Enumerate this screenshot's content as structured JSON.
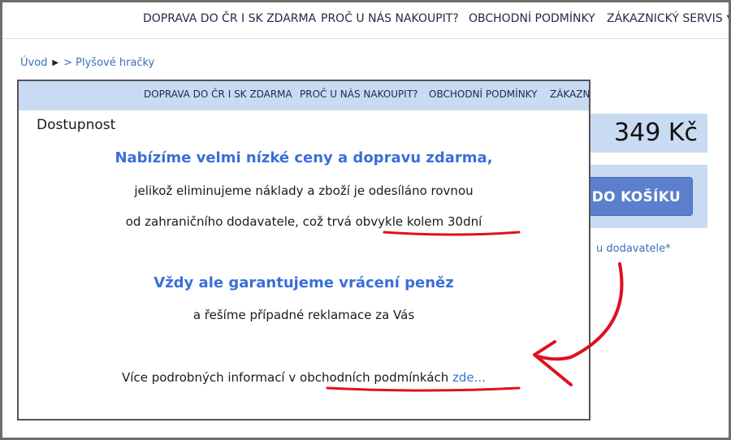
{
  "top_nav": {
    "items": [
      "DOPRAVA DO ČR I SK ZDARMA",
      "PROČ U NÁS NAKOUPIT?",
      "OBCHODNÍ PODMÍNKY",
      "ZÁKAZNICKÝ SERVIS"
    ]
  },
  "breadcrumb": {
    "home": "Úvod",
    "current": "> Plyšové hračky"
  },
  "product": {
    "price": "349 Kč",
    "cart_label": "DO KOŠÍKU",
    "supplier_note": "u dodavatele*"
  },
  "popup": {
    "nav_items": [
      "DOPRAVA DO ČR I SK ZDARMA",
      "PROČ U NÁS NAKOUPIT?",
      "OBCHODNÍ PODMÍNKY",
      "ZÁKAZNI"
    ],
    "title": "Dostupnost",
    "headline1": "Nabízíme velmi nízké ceny a dopravu zdarma,",
    "line1": "jelikož eliminujeme náklady a zboží je odesíláno rovnou",
    "line2": "od zahraničního dodavatele, což trvá obvykle kolem 30dní",
    "headline2": "Vždy ale garantujeme vrácení peněz",
    "line3": "a řešíme případné reklamace za Vás",
    "more_text": "Více podrobných informací v obchodních podmínkách",
    "more_link": "zde..."
  },
  "colors": {
    "accent": "#3a6fd8",
    "nav_bg": "#c9daf3",
    "button": "#5b7fcd",
    "annotation": "#e01020"
  }
}
